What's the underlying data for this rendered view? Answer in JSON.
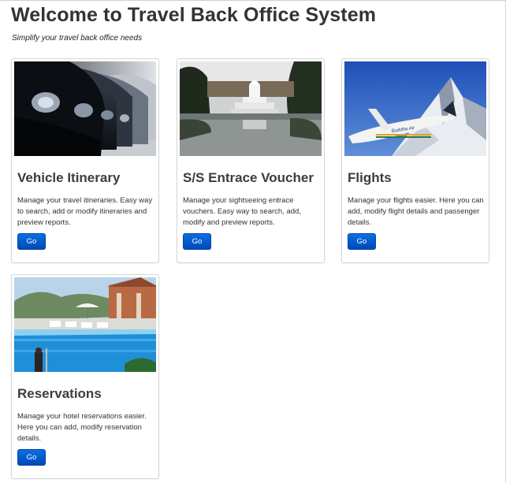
{
  "page": {
    "title": "Welcome to Travel Back Office System",
    "subtitle": "Simplify your travel back office needs"
  },
  "cards": [
    {
      "title": "Vehicle Itinerary",
      "description": "Manage your travel itineraries. Easy way to search, add or modify itineraries and preview reports.",
      "button": "Go",
      "image": "cars-photo"
    },
    {
      "title": "S/S Entrace Voucher",
      "description": "Manage your sightseeing entrace vouchers. Easy way to search, add, modify and preview reports.",
      "button": "Go",
      "image": "temple-lake-photo"
    },
    {
      "title": "Flights",
      "description": "Manage your flights easier. Here you can add, modify flight details and passenger details.",
      "button": "Go",
      "image": "airplane-mountain-photo",
      "photo_text": "Buddha Air"
    },
    {
      "title": "Reservations",
      "description": "Manage your hotel reservations easier. Here you can add, modify reservation details.",
      "button": "Go",
      "image": "hotel-pool-photo"
    }
  ]
}
